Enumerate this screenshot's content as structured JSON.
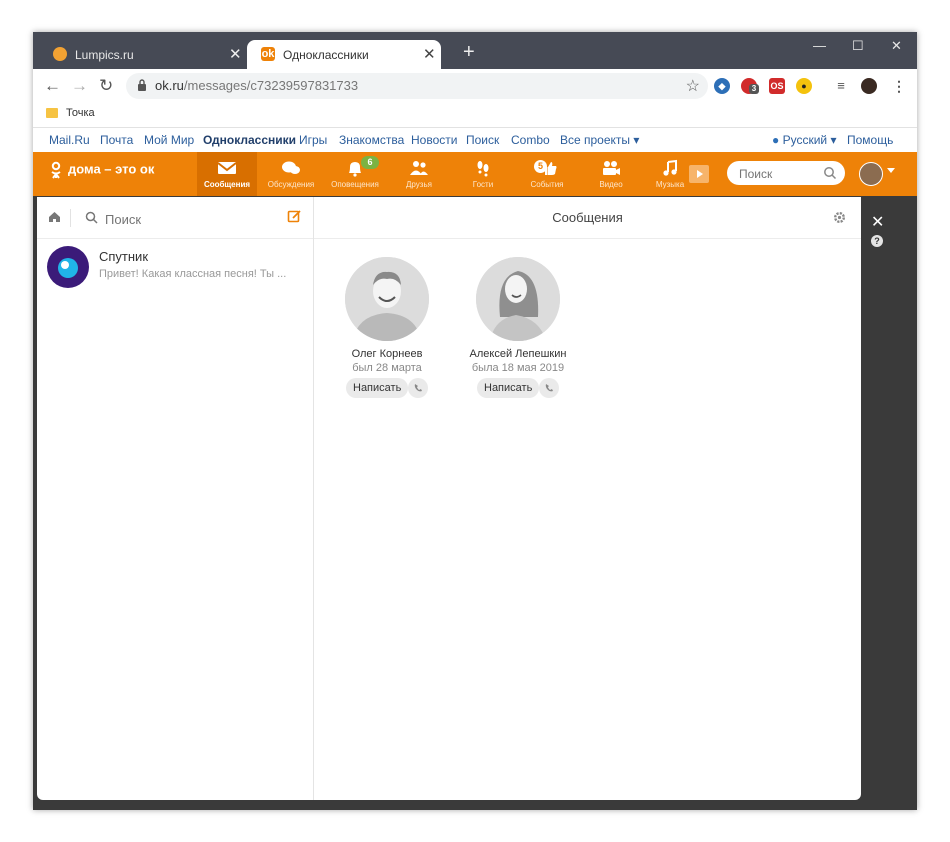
{
  "browser": {
    "tabs": [
      {
        "title": "Lumpics.ru",
        "active": false
      },
      {
        "title": "Одноклассники",
        "active": true
      }
    ],
    "url_host": "ok.ru",
    "url_path": "/messages/c73239597831733",
    "extensions": [
      {
        "name": "extension-badge-count",
        "badge": "3"
      },
      {
        "name": "opera-speed-dial",
        "label": "OS"
      }
    ],
    "bookmarks": [
      {
        "label": "Точка"
      }
    ]
  },
  "portal": {
    "links": [
      "Mail.Ru",
      "Почта",
      "Мой Мир",
      "Одноклассники",
      "Игры",
      "Знакомства",
      "Новости",
      "Поиск",
      "Combo",
      "Все проекты"
    ],
    "language": "Русский",
    "help": "Помощь"
  },
  "ok_nav": {
    "logo": "дома – это ок",
    "items": [
      {
        "label": "Сообщения",
        "icon": "envelope-icon",
        "badge": ""
      },
      {
        "label": "Обсуждения",
        "icon": "chat-bubbles-icon",
        "badge": ""
      },
      {
        "label": "Оповещения",
        "icon": "bell-icon",
        "badge": "6"
      },
      {
        "label": "Друзья",
        "icon": "friends-icon",
        "badge": ""
      },
      {
        "label": "Гости",
        "icon": "footprints-icon",
        "badge": ""
      },
      {
        "label": "События",
        "icon": "like-icon",
        "badge": "5"
      },
      {
        "label": "Видео",
        "icon": "video-camera-icon",
        "badge": ""
      },
      {
        "label": "Музыка",
        "icon": "music-note-icon",
        "badge": ""
      }
    ],
    "search_placeholder": "Поиск"
  },
  "messenger": {
    "search_placeholder": "Поиск",
    "title": "Сообщения",
    "chats": [
      {
        "name": "Спутник",
        "preview": "Привет! Какая классная песня! Ты ..."
      }
    ],
    "contacts": [
      {
        "name": "Олег Корнеев",
        "seen": "был 28 марта",
        "write": "Написать"
      },
      {
        "name": "Алексей Лепешкин",
        "seen": "была 18 мая 2019",
        "write": "Написать"
      }
    ]
  },
  "colors": {
    "ok_orange": "#ee8208",
    "ok_orange_dark": "#d86f00",
    "tab_strip": "#464a55",
    "badge_green": "#7cb342",
    "link_blue": "#2c5e9c"
  }
}
